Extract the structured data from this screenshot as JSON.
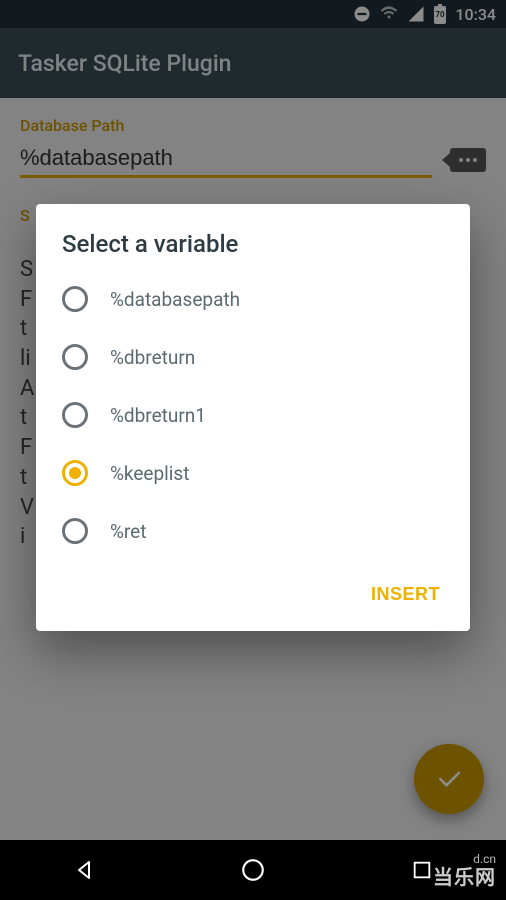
{
  "statusbar": {
    "time": "10:34",
    "battery_level": "70"
  },
  "appbar": {
    "title": "Tasker SQLite Plugin"
  },
  "form": {
    "db_path_label": "Database Path",
    "db_path_value": "%databasepath",
    "sql_label": "S"
  },
  "dialog": {
    "title": "Select a variable",
    "options": [
      {
        "label": "%databasepath",
        "selected": false
      },
      {
        "label": "%dbreturn",
        "selected": false
      },
      {
        "label": "%dbreturn1",
        "selected": false
      },
      {
        "label": "%keeplist",
        "selected": true
      },
      {
        "label": "%ret",
        "selected": false
      }
    ],
    "insert_btn": "INSERT"
  },
  "watermark": {
    "brand": "当乐网",
    "sub": "d.cn"
  }
}
